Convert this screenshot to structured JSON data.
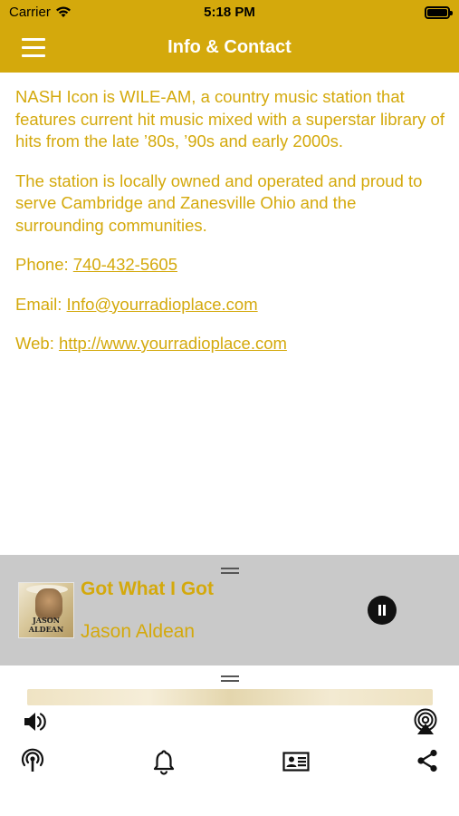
{
  "status_bar": {
    "carrier": "Carrier",
    "time": "5:18 PM"
  },
  "header": {
    "title": "Info & Contact"
  },
  "content": {
    "paragraph1": "NASH Icon is WILE-AM,  a country music station that features current hit music mixed with a superstar library of hits from the late ’80s, ’90s and early 2000s.",
    "paragraph2": "The station is locally owned and operated and proud to serve Cambridge and Zanesville Ohio and the surrounding communities.",
    "phone_label": "Phone: ",
    "phone_value": "740-432-5605",
    "email_label": "Email: ",
    "email_value": "Info@yourradioplace.com",
    "web_label": "Web: ",
    "web_value": "http://www.yourradioplace.com"
  },
  "player": {
    "track_title": "Got What I Got",
    "artist": "Jason Aldean",
    "album_art_text": "JASON ALDEAN"
  },
  "toolbar": {
    "icons": [
      "volume-icon",
      "airplay-icon",
      "podcast-icon",
      "bell-icon",
      "contact-card-icon",
      "share-icon"
    ]
  },
  "colors": {
    "brand_gold": "#d4a90c",
    "player_bg": "#c9c9c9"
  }
}
